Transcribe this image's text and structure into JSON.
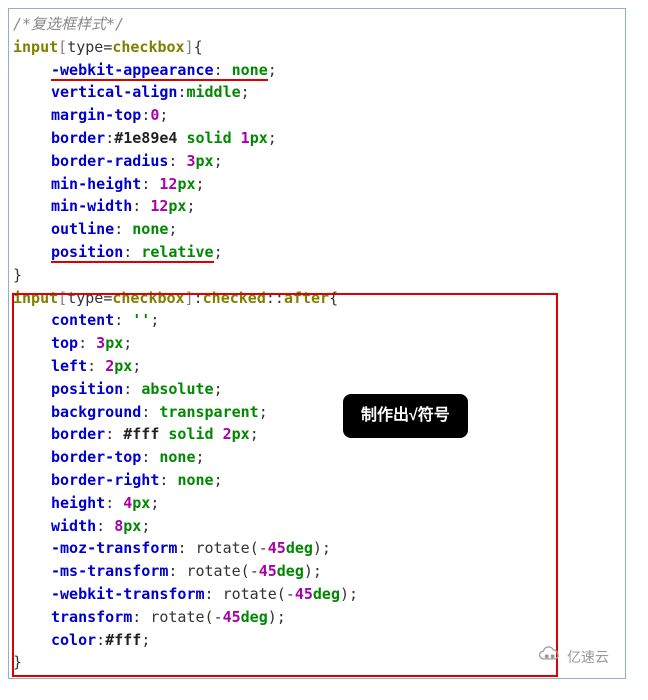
{
  "comment": "/*复选框样式*/",
  "selector1": {
    "tag": "input",
    "attr": "type",
    "val": "checkbox"
  },
  "rule1": {
    "p1": "-webkit-appearance",
    "v1": "none",
    "p2": "vertical-align",
    "v2": "middle",
    "p3": "margin-top",
    "v3n": "0",
    "p4": "border",
    "v4h": "#1e89e4",
    "v4k": "solid",
    "v4n": "1",
    "v4u": "px",
    "p5": "border-radius",
    "v5n": "3",
    "v5u": "px",
    "p6": "min-height",
    "v6n": "12",
    "v6u": "px",
    "p7": "min-width",
    "v7n": "12",
    "v7u": "px",
    "p8": "outline",
    "v8": "none",
    "p9": "position",
    "v9": "relative"
  },
  "selector2": {
    "tag": "input",
    "attr": "type",
    "val": "checkbox",
    "pseudo1": "checked",
    "pseudo2": "after"
  },
  "rule2": {
    "p1": "content",
    "v1": "''",
    "p2": "top",
    "v2n": "3",
    "v2u": "px",
    "p3": "left",
    "v3n": "2",
    "v3u": "px",
    "p4": "position",
    "v4": "absolute",
    "p5": "background",
    "v5": "transparent",
    "p6": "border",
    "v6h": "#fff",
    "v6k": "solid",
    "v6n": "2",
    "v6u": "px",
    "p7": "border-top",
    "v7": "none",
    "p8": "border-right",
    "v8": "none",
    "p9": "height",
    "v9n": "4",
    "v9u": "px",
    "p10": "width",
    "v10n": "8",
    "v10u": "px",
    "p11": "-moz-transform",
    "v11f": "rotate",
    "v11n": "-45",
    "v11u": "deg",
    "p12": "-ms-transform",
    "v12f": "rotate",
    "v12n": "-45",
    "v12u": "deg",
    "p13": "-webkit-transform",
    "v13f": "rotate",
    "v13n": "-45",
    "v13u": "deg",
    "p14": "transform",
    "v14f": "rotate",
    "v14n": "-45",
    "v14u": "deg",
    "p15": "color",
    "v15h": "#fff"
  },
  "callout": "制作出√符号",
  "watermark": "亿速云",
  "chart_data": {
    "type": "table",
    "title": "CSS checkbox styling code",
    "rules": [
      {
        "selector": "input[type=checkbox]",
        "declarations": [
          {
            "property": "-webkit-appearance",
            "value": "none",
            "highlighted": true
          },
          {
            "property": "vertical-align",
            "value": "middle"
          },
          {
            "property": "margin-top",
            "value": "0"
          },
          {
            "property": "border",
            "value": "#1e89e4 solid 1px"
          },
          {
            "property": "border-radius",
            "value": "3px"
          },
          {
            "property": "min-height",
            "value": "12px"
          },
          {
            "property": "min-width",
            "value": "12px"
          },
          {
            "property": "outline",
            "value": "none"
          },
          {
            "property": "position",
            "value": "relative",
            "highlighted": true
          }
        ]
      },
      {
        "selector": "input[type=checkbox]:checked::after",
        "boxed": true,
        "annotation": "制作出√符号",
        "declarations": [
          {
            "property": "content",
            "value": "''"
          },
          {
            "property": "top",
            "value": "3px"
          },
          {
            "property": "left",
            "value": "2px"
          },
          {
            "property": "position",
            "value": "absolute"
          },
          {
            "property": "background",
            "value": "transparent"
          },
          {
            "property": "border",
            "value": "#fff solid 2px"
          },
          {
            "property": "border-top",
            "value": "none"
          },
          {
            "property": "border-right",
            "value": "none"
          },
          {
            "property": "height",
            "value": "4px"
          },
          {
            "property": "width",
            "value": "8px"
          },
          {
            "property": "-moz-transform",
            "value": "rotate(-45deg)"
          },
          {
            "property": "-ms-transform",
            "value": "rotate(-45deg)"
          },
          {
            "property": "-webkit-transform",
            "value": "rotate(-45deg)"
          },
          {
            "property": "transform",
            "value": "rotate(-45deg)"
          },
          {
            "property": "color",
            "value": "#fff"
          }
        ]
      }
    ]
  }
}
